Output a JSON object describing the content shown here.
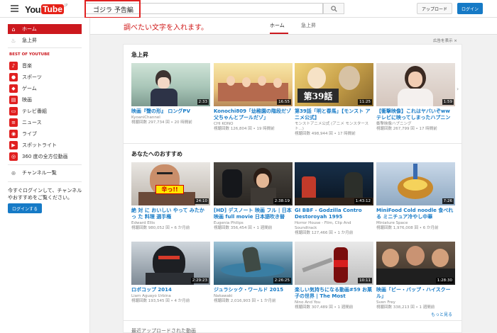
{
  "header": {
    "logo_you": "You",
    "logo_tube": "Tube",
    "logo_region": "JP",
    "search_value": "ゴジラ 予告編",
    "upload_label": "アップロード",
    "login_label": "ログイン",
    "menu_icon": "hamburger-icon",
    "search_icon": "magnifier-icon"
  },
  "annotation": {
    "text": "調べたい文字を入れます。",
    "color": "#d01a1a"
  },
  "tabs": [
    {
      "label": "ホーム",
      "active": true
    },
    {
      "label": "急上昇",
      "active": false
    }
  ],
  "sidebar": {
    "items": [
      {
        "label": "ホーム",
        "icon": "home-icon",
        "active": true
      },
      {
        "label": "急上昇",
        "icon": "flame-icon",
        "active": false
      }
    ],
    "best_of_label": "BEST OF YOUTUBE",
    "categories": [
      {
        "label": "音楽",
        "icon": "music-icon"
      },
      {
        "label": "スポーツ",
        "icon": "sports-icon"
      },
      {
        "label": "ゲーム",
        "icon": "gamepad-icon"
      },
      {
        "label": "映画",
        "icon": "film-icon"
      },
      {
        "label": "テレビ番組",
        "icon": "tv-icon"
      },
      {
        "label": "ニュース",
        "icon": "news-icon"
      },
      {
        "label": "ライブ",
        "icon": "live-icon"
      },
      {
        "label": "スポットライト",
        "icon": "spotlight-icon"
      },
      {
        "label": "360 度の全方位動画",
        "icon": "360-icon"
      }
    ],
    "channel_list_label": "チャンネル一覧",
    "login_prompt": "今すぐログインして、チャンネルやおすすめをご覧ください。",
    "login_button": "ログインする"
  },
  "ad_label": "広告を表示 ×",
  "trending": {
    "title": "急上昇",
    "videos": [
      {
        "title": "映画『聲の形』 ロングPV",
        "channel": "KyoaniChannel",
        "meta": "視聴回数 297,734 回 • 20 時間前",
        "duration": "2:33"
      },
      {
        "title": "Konochi809「幼稚園の階段だゾ 父ちゃんとプールだゾ」",
        "channel": "CHI KONO",
        "meta": "視聴回数 126,804 回 • 19 時間前",
        "duration": "16:55"
      },
      {
        "title": "第39話「明と春馬」【モンスト アニメ公式】",
        "channel": "モンストアニメ公式 (アニメ モンスタースト...)",
        "meta": "視聴回数 498,944 回 • 17 時間前",
        "duration": "11:25"
      },
      {
        "title": "【衝撃映像】これはヤバいぞww テレビに映ってしまったハプニング",
        "channel": "衝撃映像ハプニング",
        "meta": "視聴回数 267,799 回 • 17 時間前",
        "duration": "1:59"
      }
    ]
  },
  "recommended": {
    "title": "あなたへのおすすめ",
    "videos": [
      {
        "title": "絶 対 に おいしい やって みたか っ た 料理 選手権",
        "channel": "Edward Ellis",
        "meta": "視聴回数 980,052 回 • 6 か月前",
        "duration": "24:10"
      },
      {
        "title": "[HD] デスノート 映画 フル | 日本 映画 full movie 日本語吹き替え...",
        "channel": "Eugenia Philips",
        "meta": "視聴回数 356,454 回 • 1 週間前",
        "duration": "2:38:19"
      },
      {
        "title": "GI BBF - Godzilla Contro Destoroyah 1995 (Completo...",
        "channel": "Horror House - Film, Clip And Soundtrack",
        "meta": "視聴回数 127,466 回 • 1 か月前",
        "duration": "1:43:12"
      },
      {
        "title": "MiniFood Cold noodle 食べれる ミニチュア冷やし中華",
        "channel": "Miniature Space",
        "meta": "視聴回数 1,976,008 回 • 6 か月前",
        "duration": "7:26"
      }
    ]
  },
  "third_row": {
    "videos": [
      {
        "title": "ロボコップ 2014",
        "channel": "Liam Aguayo Urbina",
        "meta": "視聴回数 193,545 回 • 4 か月前",
        "duration": "2:29:23"
      },
      {
        "title": "ジュラシック・ワールド 2015",
        "channel": "Nakawaki",
        "meta": "視聴回数 2,016,903 回 • 1 か月前",
        "duration": "2:26:25"
      },
      {
        "title": "楽しい気持ちになる動画#59 お菓子の世界 | The Most Satisfyin...",
        "channel": "Nino And You",
        "meta": "視聴回数 307,489 回 • 1 週間前",
        "duration": "10:11"
      },
      {
        "title": "映画「ビー・バップ・ハイスクール」",
        "channel": "Sven Frey",
        "meta": "視聴回数 338,213 回 • 1 週間前",
        "duration": "1:28:30"
      }
    ]
  },
  "more_label": "もっと見る",
  "next_shelf_label": "最近アップロードされた動画"
}
